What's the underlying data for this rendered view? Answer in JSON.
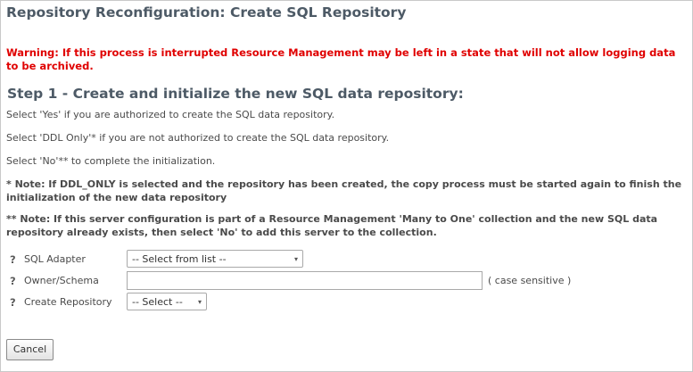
{
  "page": {
    "title": "Repository Reconfiguration: Create SQL Repository",
    "warning": "Warning: If this process is interrupted Resource Management may be left in a state that will not allow logging data to be archived."
  },
  "step": {
    "heading": "Step 1 - Create and initialize the new SQL data repository:",
    "instructions": [
      "Select 'Yes' if you are authorized to create the SQL data repository.",
      "Select 'DDL Only'* if you are not authorized to create the SQL data repository.",
      "Select 'No'** to complete the initialization."
    ],
    "notes": [
      "* Note: If DDL_ONLY is selected and the repository has been created, the copy process must be started again to finish the initialization of the new data repository",
      "** Note: If this server configuration is part of a Resource Management 'Many to One' collection and the new SQL data repository already exists, then select 'No' to add this server to the collection."
    ]
  },
  "form": {
    "help_symbol": "?",
    "sql_adapter": {
      "label": "SQL Adapter",
      "selected": "-- Select from list --"
    },
    "owner_schema": {
      "label": "Owner/Schema",
      "value": "",
      "hint": "( case sensitive )"
    },
    "create_repository": {
      "label": "Create Repository",
      "selected": "-- Select --"
    },
    "dropdown_caret": "▾"
  },
  "actions": {
    "cancel_label": "Cancel"
  }
}
